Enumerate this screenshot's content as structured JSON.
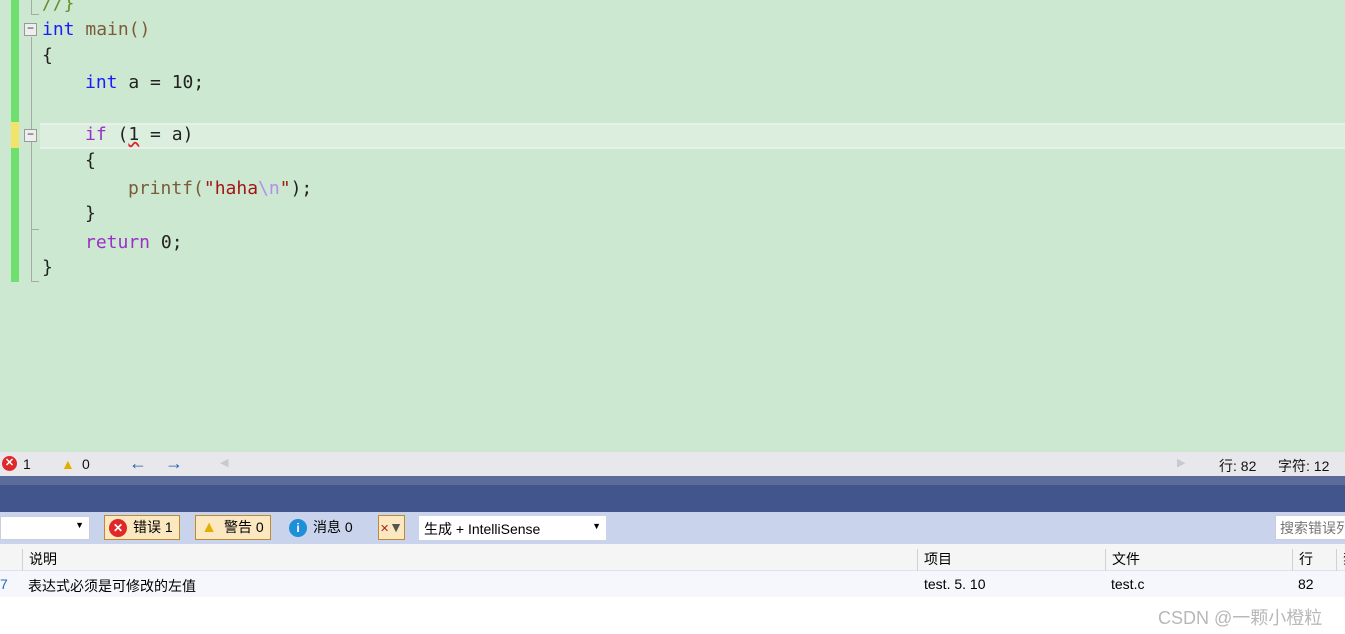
{
  "editor": {
    "lines": {
      "l0": "//}",
      "kw_int": "int",
      "main": " main()",
      "ob": "{",
      "int2": "int",
      "a_decl": " a = 10;",
      "if": "if",
      "if_rest1": " (",
      "if_one": "1",
      "if_rest2": " = a)",
      "ob2": "{",
      "printf": "printf(",
      "str1": "\"haha",
      "esc": "\\n",
      "str2": "\"",
      "end": ");",
      "cb2": "}",
      "ret": "return",
      "ret_rest": " 0;",
      "cb": "}"
    }
  },
  "status": {
    "errors": "1",
    "warnings": "0",
    "line": "行: 82",
    "char": "字符: 12"
  },
  "toolbar": {
    "errors": "错误 1",
    "warnings": "警告 0",
    "messages": "消息 0",
    "scope": "生成 + IntelliSense",
    "search_placeholder": "搜索错误列表"
  },
  "table": {
    "headers": [
      "说明",
      "项目",
      "文件",
      "行",
      "禁"
    ],
    "rows": [
      {
        "code": "7",
        "description": "表达式必须是可修改的左值",
        "project": "test. 5. 10",
        "file": "test.c",
        "line": "82"
      }
    ]
  },
  "watermark": "CSDN @一颗小橙粒"
}
